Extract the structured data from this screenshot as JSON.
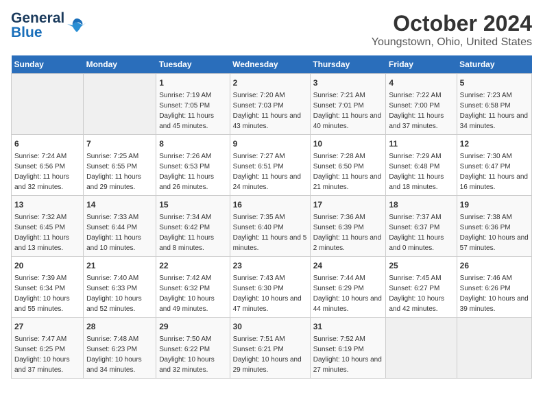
{
  "header": {
    "logo_line1": "General",
    "logo_line2": "Blue",
    "title": "October 2024",
    "subtitle": "Youngstown, Ohio, United States"
  },
  "days_of_week": [
    "Sunday",
    "Monday",
    "Tuesday",
    "Wednesday",
    "Thursday",
    "Friday",
    "Saturday"
  ],
  "weeks": [
    [
      {
        "day": "",
        "sunrise": "",
        "sunset": "",
        "daylight": ""
      },
      {
        "day": "",
        "sunrise": "",
        "sunset": "",
        "daylight": ""
      },
      {
        "day": "1",
        "sunrise": "Sunrise: 7:19 AM",
        "sunset": "Sunset: 7:05 PM",
        "daylight": "Daylight: 11 hours and 45 minutes."
      },
      {
        "day": "2",
        "sunrise": "Sunrise: 7:20 AM",
        "sunset": "Sunset: 7:03 PM",
        "daylight": "Daylight: 11 hours and 43 minutes."
      },
      {
        "day": "3",
        "sunrise": "Sunrise: 7:21 AM",
        "sunset": "Sunset: 7:01 PM",
        "daylight": "Daylight: 11 hours and 40 minutes."
      },
      {
        "day": "4",
        "sunrise": "Sunrise: 7:22 AM",
        "sunset": "Sunset: 7:00 PM",
        "daylight": "Daylight: 11 hours and 37 minutes."
      },
      {
        "day": "5",
        "sunrise": "Sunrise: 7:23 AM",
        "sunset": "Sunset: 6:58 PM",
        "daylight": "Daylight: 11 hours and 34 minutes."
      }
    ],
    [
      {
        "day": "6",
        "sunrise": "Sunrise: 7:24 AM",
        "sunset": "Sunset: 6:56 PM",
        "daylight": "Daylight: 11 hours and 32 minutes."
      },
      {
        "day": "7",
        "sunrise": "Sunrise: 7:25 AM",
        "sunset": "Sunset: 6:55 PM",
        "daylight": "Daylight: 11 hours and 29 minutes."
      },
      {
        "day": "8",
        "sunrise": "Sunrise: 7:26 AM",
        "sunset": "Sunset: 6:53 PM",
        "daylight": "Daylight: 11 hours and 26 minutes."
      },
      {
        "day": "9",
        "sunrise": "Sunrise: 7:27 AM",
        "sunset": "Sunset: 6:51 PM",
        "daylight": "Daylight: 11 hours and 24 minutes."
      },
      {
        "day": "10",
        "sunrise": "Sunrise: 7:28 AM",
        "sunset": "Sunset: 6:50 PM",
        "daylight": "Daylight: 11 hours and 21 minutes."
      },
      {
        "day": "11",
        "sunrise": "Sunrise: 7:29 AM",
        "sunset": "Sunset: 6:48 PM",
        "daylight": "Daylight: 11 hours and 18 minutes."
      },
      {
        "day": "12",
        "sunrise": "Sunrise: 7:30 AM",
        "sunset": "Sunset: 6:47 PM",
        "daylight": "Daylight: 11 hours and 16 minutes."
      }
    ],
    [
      {
        "day": "13",
        "sunrise": "Sunrise: 7:32 AM",
        "sunset": "Sunset: 6:45 PM",
        "daylight": "Daylight: 11 hours and 13 minutes."
      },
      {
        "day": "14",
        "sunrise": "Sunrise: 7:33 AM",
        "sunset": "Sunset: 6:44 PM",
        "daylight": "Daylight: 11 hours and 10 minutes."
      },
      {
        "day": "15",
        "sunrise": "Sunrise: 7:34 AM",
        "sunset": "Sunset: 6:42 PM",
        "daylight": "Daylight: 11 hours and 8 minutes."
      },
      {
        "day": "16",
        "sunrise": "Sunrise: 7:35 AM",
        "sunset": "Sunset: 6:40 PM",
        "daylight": "Daylight: 11 hours and 5 minutes."
      },
      {
        "day": "17",
        "sunrise": "Sunrise: 7:36 AM",
        "sunset": "Sunset: 6:39 PM",
        "daylight": "Daylight: 11 hours and 2 minutes."
      },
      {
        "day": "18",
        "sunrise": "Sunrise: 7:37 AM",
        "sunset": "Sunset: 6:37 PM",
        "daylight": "Daylight: 11 hours and 0 minutes."
      },
      {
        "day": "19",
        "sunrise": "Sunrise: 7:38 AM",
        "sunset": "Sunset: 6:36 PM",
        "daylight": "Daylight: 10 hours and 57 minutes."
      }
    ],
    [
      {
        "day": "20",
        "sunrise": "Sunrise: 7:39 AM",
        "sunset": "Sunset: 6:34 PM",
        "daylight": "Daylight: 10 hours and 55 minutes."
      },
      {
        "day": "21",
        "sunrise": "Sunrise: 7:40 AM",
        "sunset": "Sunset: 6:33 PM",
        "daylight": "Daylight: 10 hours and 52 minutes."
      },
      {
        "day": "22",
        "sunrise": "Sunrise: 7:42 AM",
        "sunset": "Sunset: 6:32 PM",
        "daylight": "Daylight: 10 hours and 49 minutes."
      },
      {
        "day": "23",
        "sunrise": "Sunrise: 7:43 AM",
        "sunset": "Sunset: 6:30 PM",
        "daylight": "Daylight: 10 hours and 47 minutes."
      },
      {
        "day": "24",
        "sunrise": "Sunrise: 7:44 AM",
        "sunset": "Sunset: 6:29 PM",
        "daylight": "Daylight: 10 hours and 44 minutes."
      },
      {
        "day": "25",
        "sunrise": "Sunrise: 7:45 AM",
        "sunset": "Sunset: 6:27 PM",
        "daylight": "Daylight: 10 hours and 42 minutes."
      },
      {
        "day": "26",
        "sunrise": "Sunrise: 7:46 AM",
        "sunset": "Sunset: 6:26 PM",
        "daylight": "Daylight: 10 hours and 39 minutes."
      }
    ],
    [
      {
        "day": "27",
        "sunrise": "Sunrise: 7:47 AM",
        "sunset": "Sunset: 6:25 PM",
        "daylight": "Daylight: 10 hours and 37 minutes."
      },
      {
        "day": "28",
        "sunrise": "Sunrise: 7:48 AM",
        "sunset": "Sunset: 6:23 PM",
        "daylight": "Daylight: 10 hours and 34 minutes."
      },
      {
        "day": "29",
        "sunrise": "Sunrise: 7:50 AM",
        "sunset": "Sunset: 6:22 PM",
        "daylight": "Daylight: 10 hours and 32 minutes."
      },
      {
        "day": "30",
        "sunrise": "Sunrise: 7:51 AM",
        "sunset": "Sunset: 6:21 PM",
        "daylight": "Daylight: 10 hours and 29 minutes."
      },
      {
        "day": "31",
        "sunrise": "Sunrise: 7:52 AM",
        "sunset": "Sunset: 6:19 PM",
        "daylight": "Daylight: 10 hours and 27 minutes."
      },
      {
        "day": "",
        "sunrise": "",
        "sunset": "",
        "daylight": ""
      },
      {
        "day": "",
        "sunrise": "",
        "sunset": "",
        "daylight": ""
      }
    ]
  ]
}
